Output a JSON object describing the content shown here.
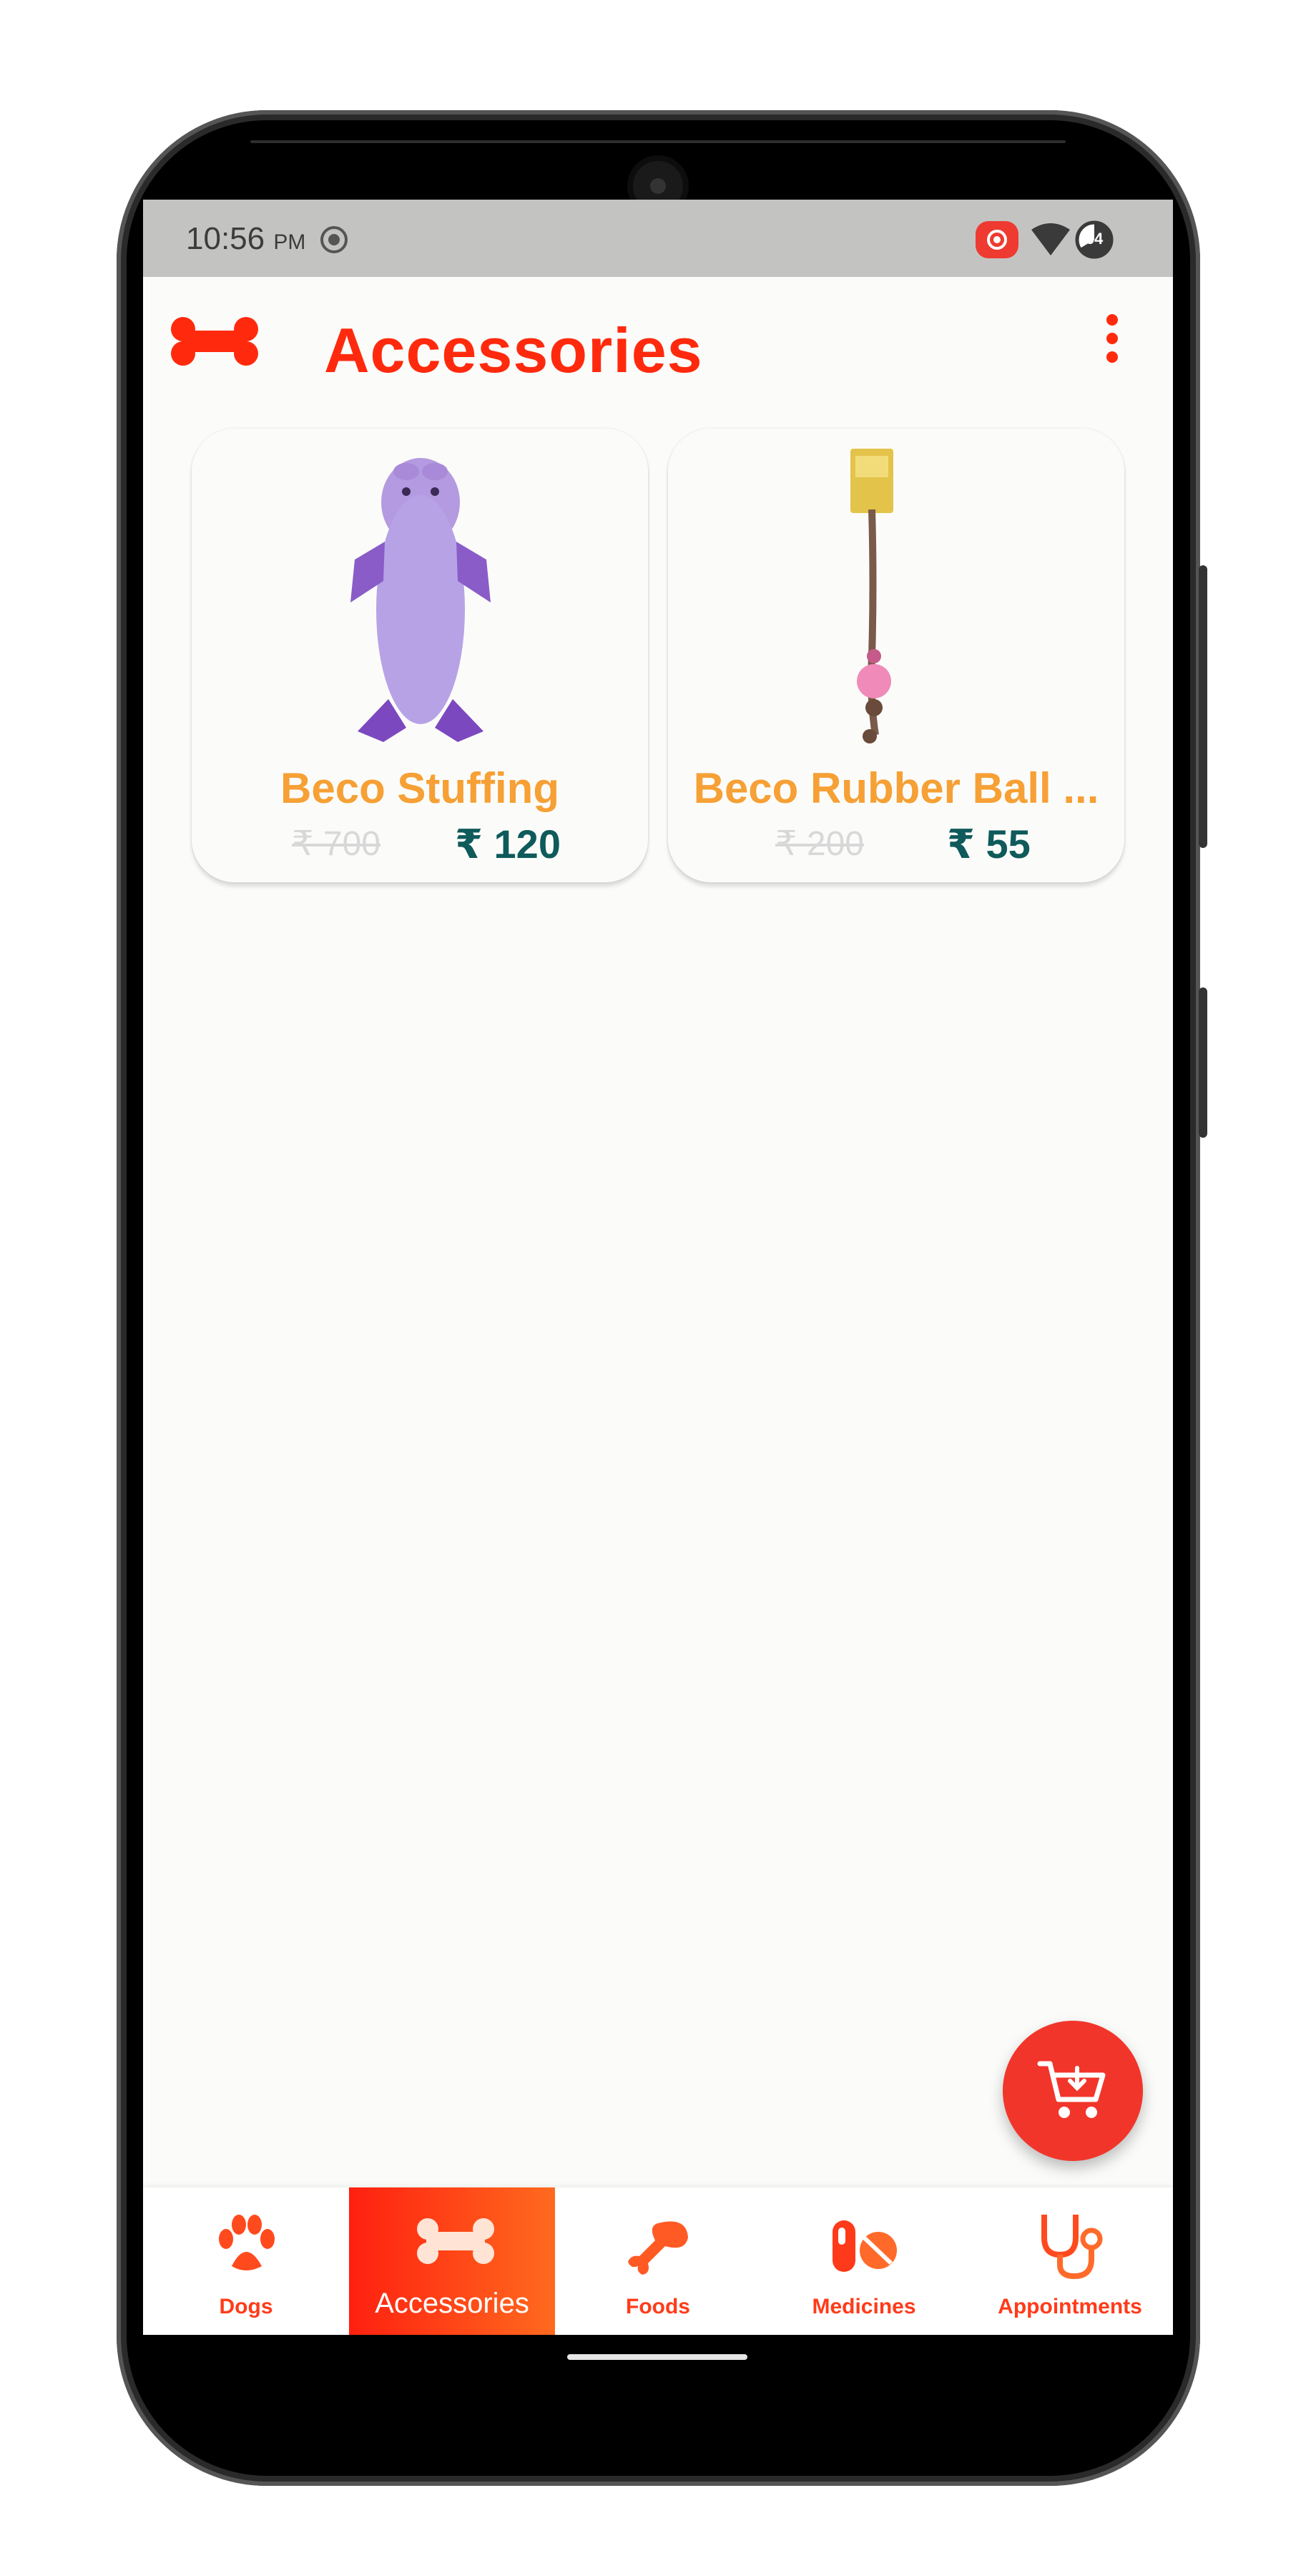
{
  "status": {
    "time": "10:56",
    "ampm": "PM",
    "battery": "64"
  },
  "appbar": {
    "title": "Accessories"
  },
  "products": [
    {
      "name": "Beco Stuffing",
      "old_price": "₹ 700",
      "price": "₹ 120"
    },
    {
      "name": "Beco Rubber Ball ...",
      "old_price": "₹ 200",
      "price": "₹ 55"
    }
  ],
  "nav": {
    "items": [
      {
        "label": "Dogs",
        "icon": "paw-icon",
        "active": false
      },
      {
        "label": "Accessories",
        "icon": "bone-icon",
        "active": true
      },
      {
        "label": "Foods",
        "icon": "drumstick-icon",
        "active": false
      },
      {
        "label": "Medicines",
        "icon": "pills-icon",
        "active": false
      },
      {
        "label": "Appointments",
        "icon": "stethoscope-icon",
        "active": false
      }
    ]
  },
  "colors": {
    "accent": "#ff2a0d",
    "product_title": "#f6a035",
    "price": "#0f5a5a",
    "old_price": "#d8d8d8",
    "fab": "#f2352a"
  }
}
